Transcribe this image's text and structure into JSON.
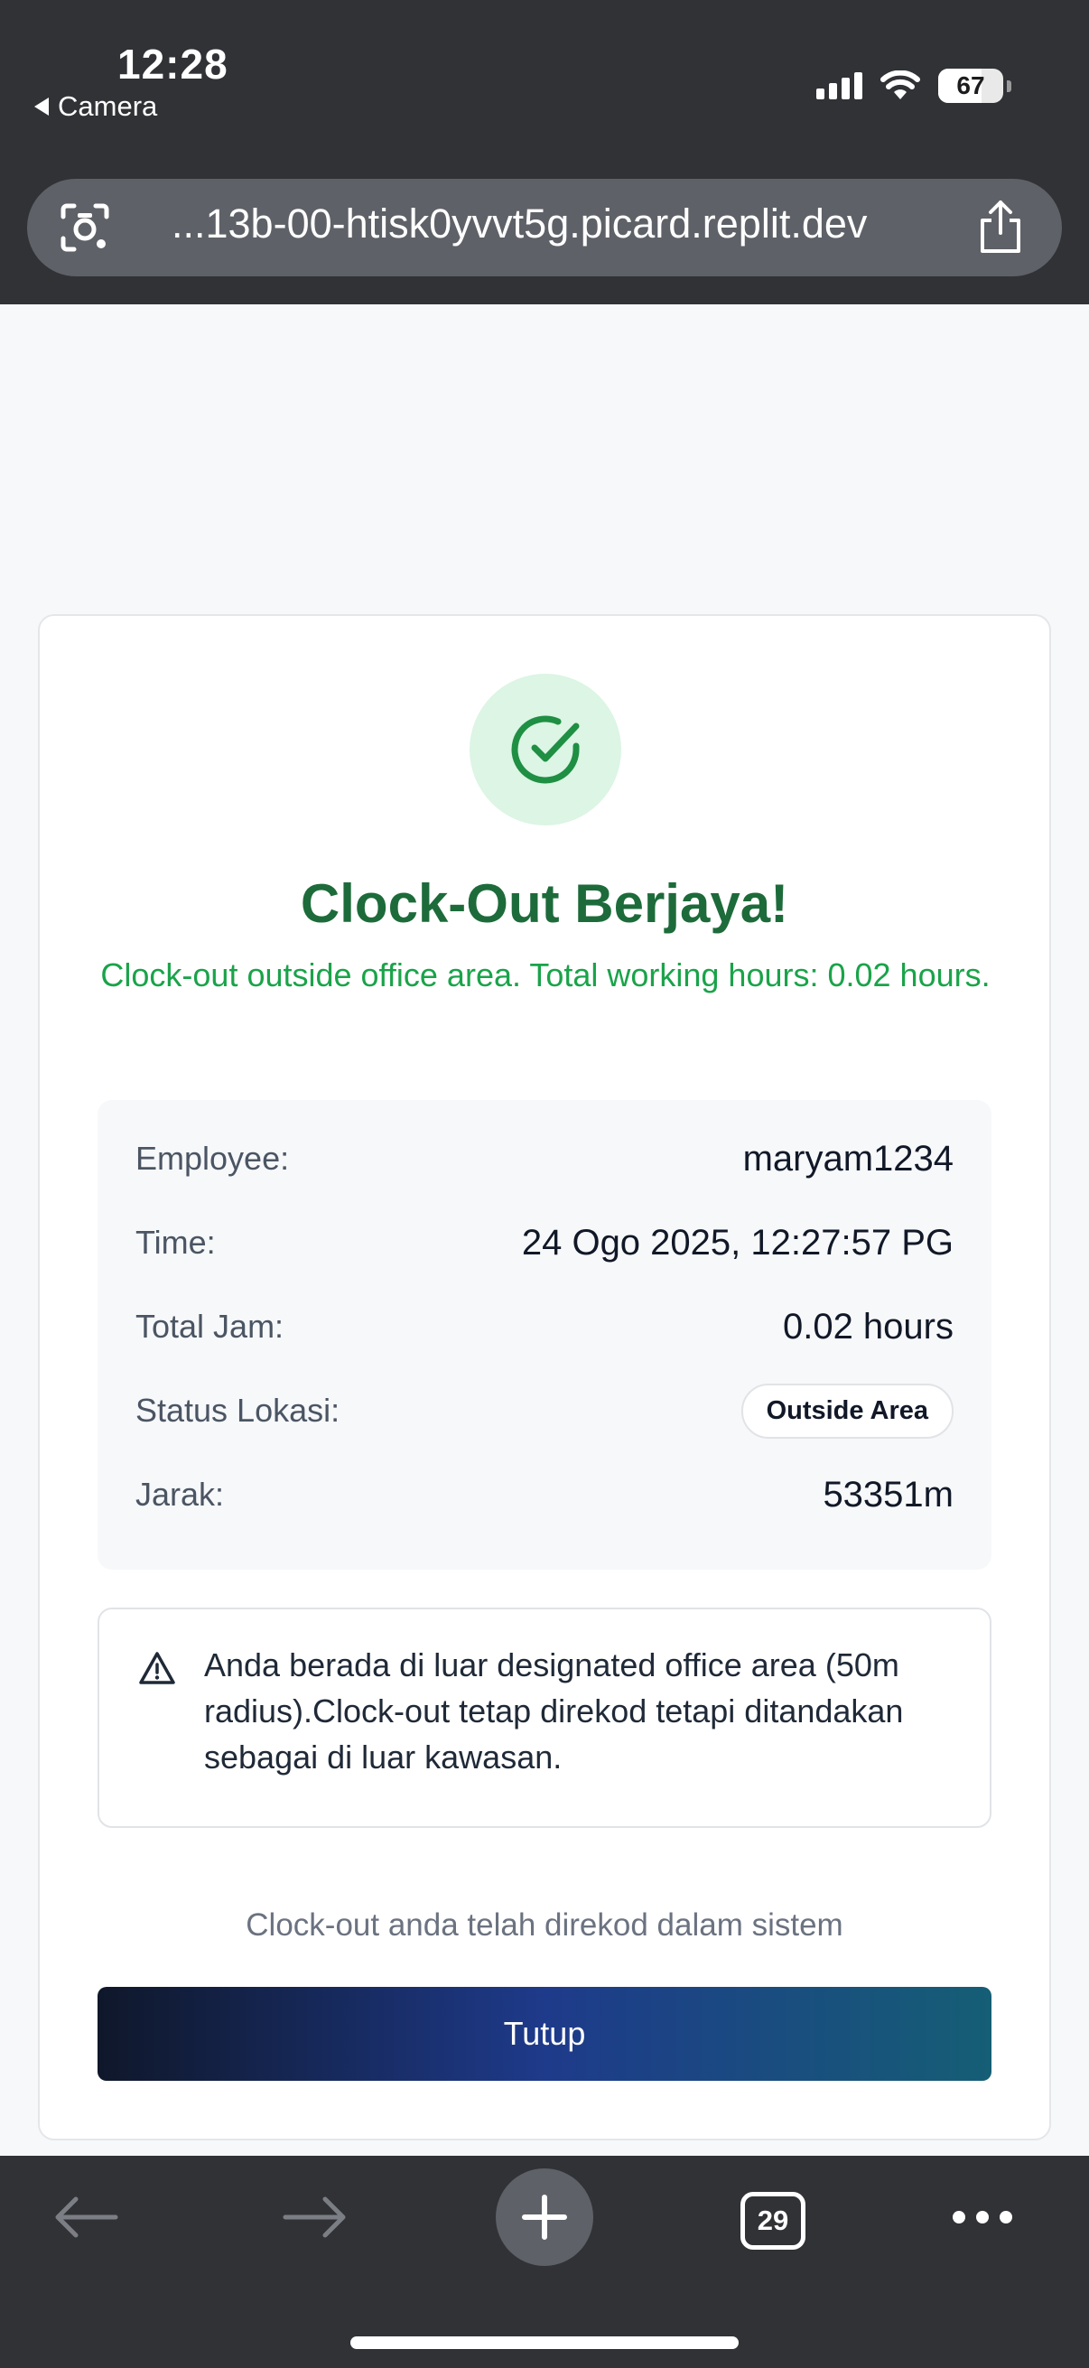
{
  "status_bar": {
    "time": "12:28",
    "back_app": "Camera",
    "battery": "67",
    "battery_level": 0.67
  },
  "browser": {
    "url": "...13b-00-htisk0yvvt5g.picard.replit.dev",
    "open_tabs": "29",
    "icons": [
      "visual-search-icon",
      "share-icon",
      "back-arrow-icon",
      "forward-arrow-icon",
      "new-tab-icon",
      "tabs-icon",
      "more-icon"
    ]
  },
  "card": {
    "title": "Clock-Out Berjaya!",
    "subtitle": "Clock-out outside office area. Total working hours: 0.02 hours.",
    "details": {
      "employee_label": "Employee:",
      "employee_value": "maryam1234",
      "time_label": "Time:",
      "time_value": "24 Ogo 2025, 12:27:57 PG",
      "total_label": "Total Jam:",
      "total_value": "0.02 hours",
      "status_label": "Status Lokasi:",
      "status_value": "Outside Area",
      "distance_label": "Jarak:",
      "distance_value": "53351m"
    },
    "warning": "Anda berada di luar designated office area (50m radius).Clock-out tetap direkod tetapi ditandakan sebagai di luar kawasan.",
    "note": "Clock-out anda telah direkod dalam sistem",
    "close_label": "Tutup"
  },
  "colors": {
    "success_dark": "#1d6b3a",
    "success": "#1aa34a",
    "success_bg": "#dcf5e4",
    "chrome": "#303236",
    "button_gradient": [
      "#0f172a",
      "#1e3a8a",
      "#155e75"
    ]
  }
}
